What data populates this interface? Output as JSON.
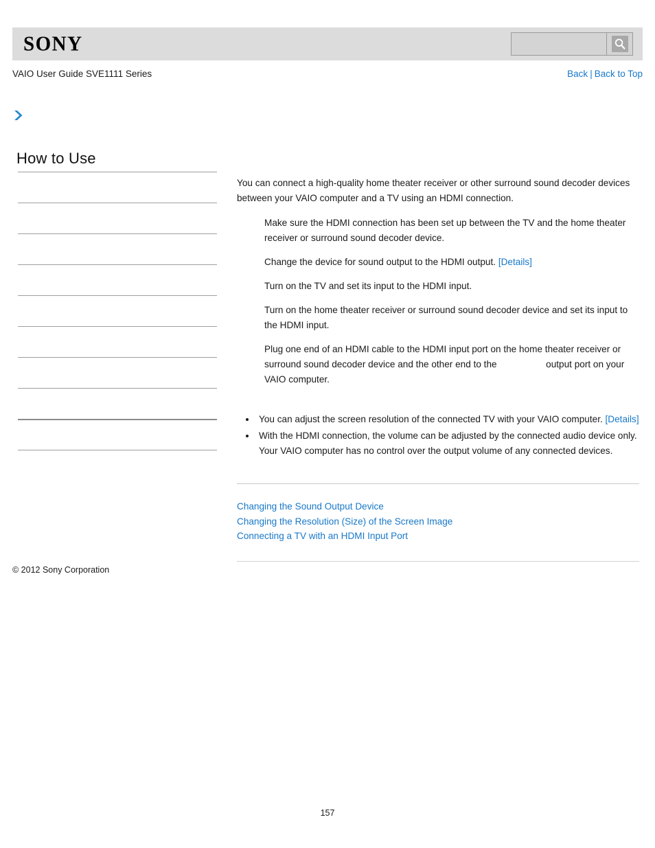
{
  "header": {
    "logo_text": "SONY",
    "search": {
      "value": "",
      "placeholder": "",
      "icon": "search-icon"
    }
  },
  "subheader": {
    "guide_title": "VAIO User Guide SVE1111 Series",
    "back_label": "Back",
    "separator": "|",
    "back_to_top_label": "Back to Top"
  },
  "sidebar": {
    "toggle_icon": "chevron-right-icon",
    "title": "How to Use",
    "items": [
      {
        "label": ""
      },
      {
        "label": ""
      },
      {
        "label": ""
      },
      {
        "label": ""
      },
      {
        "label": ""
      },
      {
        "label": ""
      },
      {
        "label": ""
      },
      {
        "label": ""
      },
      {
        "label": ""
      },
      {
        "label": ""
      }
    ]
  },
  "main": {
    "intro": "You can connect a high-quality home theater receiver or other surround sound decoder devices between your VAIO computer and a TV using an HDMI connection.",
    "steps": [
      {
        "text": "Make sure the HDMI connection has been set up between the TV and the home theater receiver or surround sound decoder device."
      },
      {
        "text": "Change the device for sound output to the HDMI output.",
        "link": "[Details]"
      },
      {
        "text": "Turn on the TV and set its input to the HDMI input."
      },
      {
        "text": "Turn on the home theater receiver or surround sound decoder device and set its input to the HDMI input."
      },
      {
        "text_before": "Plug one end of an HDMI cable to the HDMI input port on the home theater receiver or surround sound decoder device and the other end to the",
        "text_after": "output port on your VAIO computer."
      }
    ],
    "notes": [
      {
        "text": "You can adjust the screen resolution of the connected TV with your VAIO computer.",
        "link": "[Details]"
      },
      {
        "text": "With the HDMI connection, the volume can be adjusted by the connected audio device only. Your VAIO computer has no control over the output volume of any connected devices."
      }
    ],
    "related_links": [
      "Changing the Sound Output Device",
      "Changing the Resolution (Size) of the Screen Image",
      "Connecting a TV with an HDMI Input Port"
    ]
  },
  "footer": {
    "copyright": "© 2012 Sony Corporation",
    "page_number": "157"
  },
  "colors": {
    "link": "#1878c8",
    "header_bg": "#dcdcdc",
    "rule": "#c9c9c9"
  }
}
